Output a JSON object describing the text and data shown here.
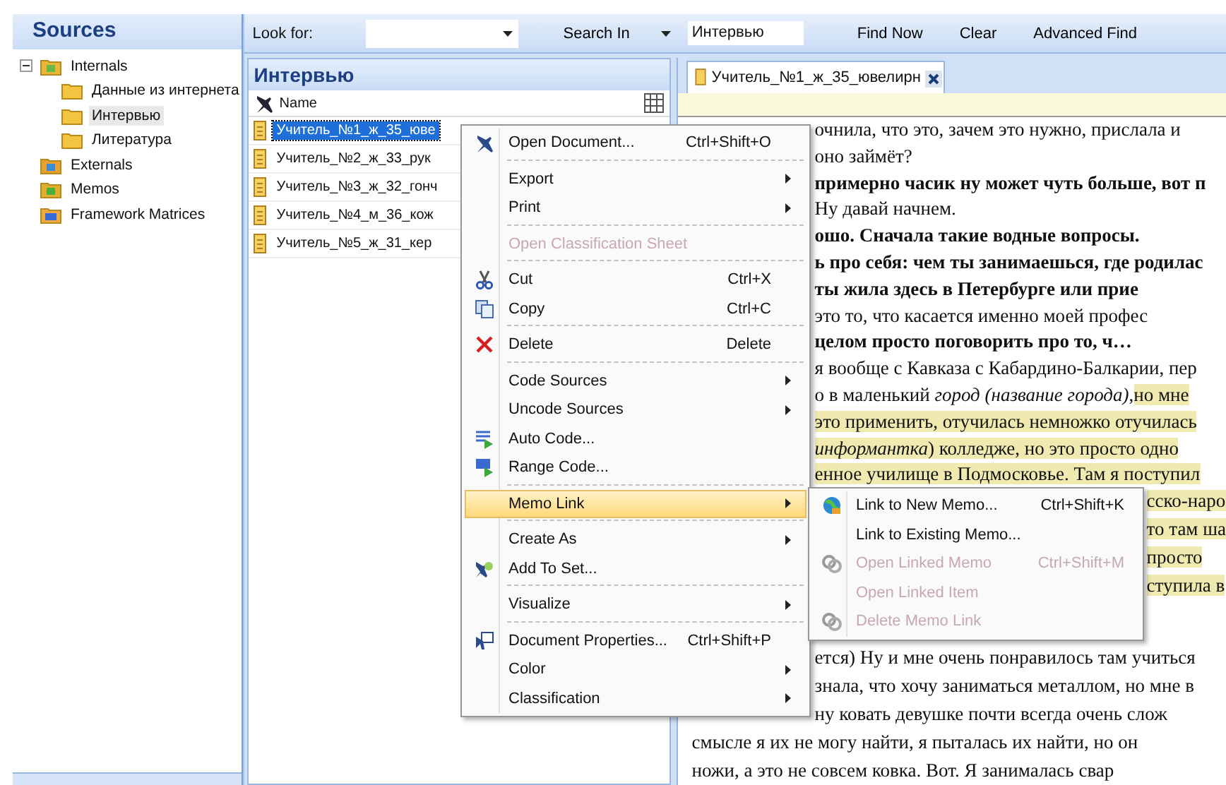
{
  "sources": {
    "title": "Sources",
    "tree": [
      {
        "label": "Internals",
        "kind": "internals",
        "expanded": true,
        "selected": false,
        "children": [
          {
            "label": "Данные из интернета",
            "kind": "folder",
            "selected": false
          },
          {
            "label": "Интервью",
            "kind": "folder",
            "selected": true
          },
          {
            "label": "Литература",
            "kind": "folder",
            "selected": false
          }
        ]
      },
      {
        "label": "Externals",
        "kind": "externals",
        "selected": false
      },
      {
        "label": "Memos",
        "kind": "memos",
        "selected": false
      },
      {
        "label": "Framework Matrices",
        "kind": "matrices",
        "selected": false
      }
    ]
  },
  "toolbar": {
    "look_for_label": "Look for:",
    "search_in": "Search In",
    "search_in_value": "Интервью",
    "find_now": "Find Now",
    "clear": "Clear",
    "advanced_find": "Advanced Find"
  },
  "list": {
    "title": "Интервью",
    "column": "Name",
    "rows": [
      {
        "name": "Учитель_№1_ж_35_юве",
        "selected": true
      },
      {
        "name": "Учитель_№2_ж_33_рук",
        "selected": false
      },
      {
        "name": "Учитель_№3_ж_32_гонч",
        "selected": false
      },
      {
        "name": "Учитель_№4_м_36_кож",
        "selected": false
      },
      {
        "name": "Учитель_№5_ж_31_кер",
        "selected": false
      }
    ]
  },
  "document": {
    "tab": "Учитель_№1_ж_35_ювелирн",
    "lines": [
      {
        "kind": "menu",
        "bold": false,
        "parts": [
          {
            "text": "очнила, что это, зачем это нужно, прислала и",
            "highlighted": false
          }
        ]
      },
      {
        "kind": "menu",
        "bold": false,
        "parts": [
          {
            "text": "оно займёт?",
            "highlighted": false
          }
        ]
      },
      {
        "kind": "menu",
        "bold": true,
        "parts": [
          {
            "text": "примерно часик ну может чуть больше, вот п",
            "highlighted": false
          }
        ]
      },
      {
        "kind": "menu",
        "bold": false,
        "parts": [
          {
            "text": "Ну давай начнем.",
            "highlighted": false
          }
        ]
      },
      {
        "kind": "menu",
        "bold": true,
        "parts": [
          {
            "text": "ошо. Сначала такие водные вопросы.",
            "highlighted": false
          }
        ]
      },
      {
        "kind": "menu",
        "bold": true,
        "parts": [
          {
            "text": "ь про себя: чем ты занимаешься, где родилас",
            "highlighted": false
          }
        ]
      },
      {
        "kind": "menu",
        "bold": true,
        "parts": [
          {
            "text": "ты жила здесь в Петербурге или прие",
            "highlighted": false
          }
        ]
      },
      {
        "kind": "menu",
        "bold": false,
        "parts": [
          {
            "text": "это то, что касается именно моей профес",
            "highlighted": false
          }
        ]
      },
      {
        "kind": "menu",
        "bold": true,
        "parts": [
          {
            "text": "целом просто поговорить про то, ч…",
            "highlighted": false
          }
        ]
      },
      {
        "kind": "menu",
        "bold": false,
        "parts": [
          {
            "text": "я вообще с Кавказа с Кабардино-Балкарии, пер",
            "highlighted": false
          }
        ]
      },
      {
        "kind": "menu",
        "bold": false,
        "parts": [
          {
            "text": "о в маленький *город (название города)*,",
            "highlighted": false
          },
          {
            "text": "но мне",
            "highlighted": true
          }
        ]
      },
      {
        "kind": "menu",
        "bold": false,
        "parts": [
          {
            "text": "это применить, отучилась немножко отучилась",
            "highlighted": true
          }
        ]
      },
      {
        "kind": "menu",
        "bold": false,
        "parts": [
          {
            "text": "*информантка*) колледже, но это просто одно",
            "highlighted": true
          }
        ]
      },
      {
        "kind": "menu",
        "bold": false,
        "parts": [
          {
            "text": "енное училище в Подмосковье. Там я поступил",
            "highlighted": true
          }
        ]
      },
      {
        "kind": "submenu",
        "bold": false,
        "parts": [
          {
            "text": "сско-наро",
            "highlighted": true
          }
        ]
      },
      {
        "kind": "submenu",
        "bold": false,
        "parts": [
          {
            "text": "то там ша",
            "highlighted": true
          }
        ]
      },
      {
        "kind": "submenu",
        "bold": false,
        "parts": [
          {
            "text": "просто",
            "highlighted": true
          }
        ]
      },
      {
        "kind": "submenu",
        "bold": false,
        "parts": [
          {
            "text": "ступила в",
            "highlighted": true
          }
        ]
      },
      {
        "kind": "menu",
        "bold": false,
        "parts": [
          {
            "text": "ется) Ну и мне очень понравилось там учиться",
            "highlighted": false
          }
        ]
      },
      {
        "kind": "menu",
        "bold": false,
        "parts": [
          {
            "text": "знала, что хочу заниматься металлом, но мне в",
            "highlighted": false
          }
        ]
      },
      {
        "kind": "menu",
        "bold": false,
        "parts": [
          {
            "text": "ну ковать девушке почти всегда очень слож",
            "highlighted": false
          }
        ]
      },
      {
        "kind": "full",
        "bold": false,
        "parts": [
          {
            "text": "смысле я их не могу найти, я пыталась их найти, но он",
            "highlighted": false
          }
        ]
      },
      {
        "kind": "full",
        "bold": false,
        "parts": [
          {
            "text": "ножи, а это не совсем ковка. Вот. Я занималась свар",
            "highlighted": false
          }
        ]
      }
    ]
  },
  "context_menu": {
    "items": [
      {
        "label": "Open Document...",
        "shortcut": "Ctrl+Shift+O",
        "submenu": false,
        "disabled": false,
        "selected": false,
        "separator_after": true
      },
      {
        "label": "Export",
        "submenu": true,
        "disabled": false,
        "selected": false,
        "separator_after": false
      },
      {
        "label": "Print",
        "submenu": true,
        "disabled": false,
        "selected": false,
        "separator_after": true
      },
      {
        "label": "Open Classification Sheet",
        "submenu": false,
        "disabled": true,
        "selected": false,
        "separator_after": true
      },
      {
        "label": "Cut",
        "shortcut": "Ctrl+X",
        "submenu": false,
        "disabled": false,
        "selected": false,
        "separator_after": false
      },
      {
        "label": "Copy",
        "shortcut": "Ctrl+C",
        "submenu": false,
        "disabled": false,
        "selected": false,
        "separator_after": true
      },
      {
        "label": "Delete",
        "shortcut": "Delete",
        "submenu": false,
        "disabled": false,
        "selected": false,
        "separator_after": true
      },
      {
        "label": "Code Sources",
        "submenu": true,
        "disabled": false,
        "selected": false,
        "separator_after": false
      },
      {
        "label": "Uncode Sources",
        "submenu": true,
        "disabled": false,
        "selected": false,
        "separator_after": false
      },
      {
        "label": "Auto Code...",
        "submenu": false,
        "disabled": false,
        "selected": false,
        "separator_after": false
      },
      {
        "label": "Range Code...",
        "submenu": false,
        "disabled": false,
        "selected": false,
        "separator_after": true
      },
      {
        "label": "Memo Link",
        "submenu": true,
        "disabled": false,
        "selected": true,
        "separator_after": true
      },
      {
        "label": "Create As",
        "submenu": true,
        "disabled": false,
        "selected": false,
        "separator_after": false
      },
      {
        "label": "Add To Set...",
        "submenu": false,
        "disabled": false,
        "selected": false,
        "separator_after": true
      },
      {
        "label": "Visualize",
        "submenu": true,
        "disabled": false,
        "selected": false,
        "separator_after": true
      },
      {
        "label": "Document Properties...",
        "shortcut": "Ctrl+Shift+P",
        "submenu": false,
        "disabled": false,
        "selected": false,
        "separator_after": false
      },
      {
        "label": "Color",
        "submenu": true,
        "disabled": false,
        "selected": false,
        "separator_after": false
      },
      {
        "label": "Classification",
        "submenu": true,
        "disabled": false,
        "selected": false,
        "separator_after": false
      }
    ]
  },
  "submenu": {
    "items": [
      {
        "label": "Link to New Memo...",
        "shortcut": "Ctrl+Shift+K",
        "disabled": false
      },
      {
        "label": "Link to Existing Memo...",
        "disabled": false
      },
      {
        "label": "Open Linked Memo",
        "shortcut": "Ctrl+Shift+M",
        "disabled": true
      },
      {
        "label": "Open Linked Item",
        "disabled": true
      },
      {
        "label": "Delete Memo Link",
        "disabled": true
      }
    ]
  }
}
